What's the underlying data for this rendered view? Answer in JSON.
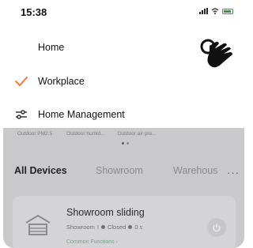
{
  "status_bar": {
    "time": "15:38"
  },
  "dropdown": {
    "items": [
      {
        "label": "Home"
      },
      {
        "label": "Workplace",
        "selected": true
      },
      {
        "label": "Home Management",
        "icon": "sliders-icon"
      }
    ]
  },
  "widgets": [
    "Outdoor PM2.5",
    "Outdoor humid...",
    "Outdoor air pre..."
  ],
  "tabs": [
    "All Devices",
    "Showroom",
    "Warehous"
  ],
  "device_card": {
    "title": "Showroom sliding",
    "room": "Showroom",
    "separator": "I",
    "state": "Closed",
    "timer": "0 s",
    "link": "Common Functions ›"
  },
  "colors": {
    "accent": "#f07a3a",
    "link": "#6fa784"
  }
}
